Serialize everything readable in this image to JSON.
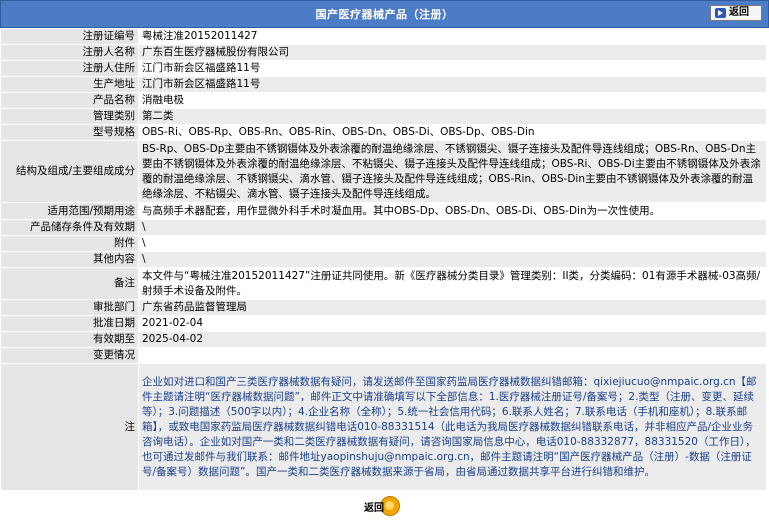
{
  "header": {
    "title": "国产医疗器械产品（注册）",
    "back_label": "返回"
  },
  "rows": [
    {
      "label": "注册证编号",
      "value": "粤械注准20152011427"
    },
    {
      "label": "注册人名称",
      "value": "广东百生医疗器械股份有限公司"
    },
    {
      "label": "注册人住所",
      "value": "江门市新会区福盛路11号"
    },
    {
      "label": "生产地址",
      "value": "江门市新会区福盛路11号"
    },
    {
      "label": "产品名称",
      "value": "消融电极"
    },
    {
      "label": "管理类别",
      "value": "第二类"
    },
    {
      "label": "型号规格",
      "value": "OBS-Ri、OBS-Rp、OBS-Rn、OBS-Rin、OBS-Dn、OBS-Di、OBS-Dp、OBS-Din"
    },
    {
      "label": "结构及组成/主要组成成分",
      "value": "BS-Rp、OBS-Dp主要由不锈钢镊体及外表涂覆的耐温绝缘涂层、不锈钢镊尖、镊子连接头及配件导连线组成；OBS-Rn、OBS-Dn主要由不锈钢镊体及外表涂覆的耐温绝缘涂层、不粘镊尖、镊子连接头及配件导连线组成；OBS-Ri、OBS-Di主要由不锈钢镊体及外表涂覆的耐温绝缘涂层、不锈钢镊尖、滴水管、镊子连接头及配件导连线组成；OBS-Rin、OBS-Din主要由不锈钢镊体及外表涂覆的耐温绝缘涂层、不粘镊尖、滴水管、镊子连接头及配件导连线组成。"
    },
    {
      "label": "适用范围/预期用途",
      "value": "与高频手术器配套，用作显微外科手术时凝血用。其中OBS-Dp、OBS-Dn、OBS-Di、OBS-Din为一次性使用。"
    },
    {
      "label": "产品储存条件及有效期",
      "value": "\\"
    },
    {
      "label": "附件",
      "value": "\\"
    },
    {
      "label": "其他内容",
      "value": "\\"
    },
    {
      "label": "备注",
      "value": "本文件与“粤械注准20152011427”注册证共同使用。新《医疗器械分类目录》管理类别：II类，分类编码：01有源手术器械-03高频/射频手术设备及附件。"
    },
    {
      "label": "审批部门",
      "value": "广东省药品监督管理局"
    },
    {
      "label": "批准日期",
      "value": "2021-02-04"
    },
    {
      "label": "有效期至",
      "value": "2025-04-02"
    },
    {
      "label": "变更情况",
      "value": ""
    }
  ],
  "note": {
    "label": "注",
    "text": "企业如对进口和国产三类医疗器械数据有疑问，请发送邮件至国家药监局医疗器械数据纠错邮箱：qixiejiucuo@nmpaic.org.cn【邮件主题请注明“医疗器械数据问题”，邮件正文中请准确填写以下全部信息：1.医疗器械注册证号/备案号；2.类型（注册、变更、延续等）；3.问题描述（500字以内）；4.企业名称（全称）；5.统一社会信用代码；6.联系人姓名；7.联系电话（手机和座机）；8.联系邮箱】，或致电国家药监局医疗器械数据纠错电话010-88331514（此电话为我局医疗器械数据纠错联系电话，并非相应产品/企业业务咨询电话）。企业如对国产一类和二类医疗器械数据有疑问，请咨询国家局信息中心，电话010-88332877，88331520（工作日），也可通过发邮件与我们联系：邮件地址yaopinshuju@nmpaic.org.cn，邮件主题请注明“国产医疗器械产品（注册）-数据（注册证号/备案号）数据问题”。国产一类和二类医疗器械数据来源于省局，由省局通过数据共享平台进行纠错和维护。"
  },
  "footer": {
    "back_label": "返回"
  }
}
